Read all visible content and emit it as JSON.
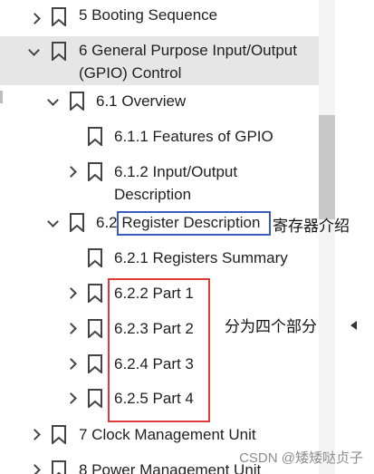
{
  "tree": {
    "items": [
      {
        "label": "5 Booting Sequence",
        "expanded": false
      },
      {
        "label_line1": "6 General Purpose Input/Output",
        "label_line2": "(GPIO) Control",
        "expanded": true,
        "selected": true
      },
      {
        "label": "6.1 Overview",
        "expanded": true
      },
      {
        "label": "6.1.1 Features of GPIO"
      },
      {
        "label_line1": "6.1.2 Input/Output",
        "label_line2": "Description",
        "expanded": false
      },
      {
        "label": "6.2 Register Description",
        "expanded": true
      },
      {
        "label": "6.2.1 Registers Summary"
      },
      {
        "label": "6.2.2 Part 1",
        "expanded": false
      },
      {
        "label": "6.2.3 Part 2",
        "expanded": false
      },
      {
        "label": "6.2.4 Part 3",
        "expanded": false
      },
      {
        "label": "6.2.5 Part 4",
        "expanded": false
      },
      {
        "label": "7 Clock Management Unit",
        "expanded": false
      },
      {
        "label": "8 Power Management Unit",
        "expanded": false
      }
    ]
  },
  "annotations": {
    "register_note": "寄存器介绍",
    "parts_note": "分为四个部分"
  },
  "watermark": "CSDN @矮矮哒贞子",
  "colors": {
    "selected_bg": "#e6e6e6",
    "blue_box": "#3a5bbf",
    "red_box": "#e03a3a"
  }
}
